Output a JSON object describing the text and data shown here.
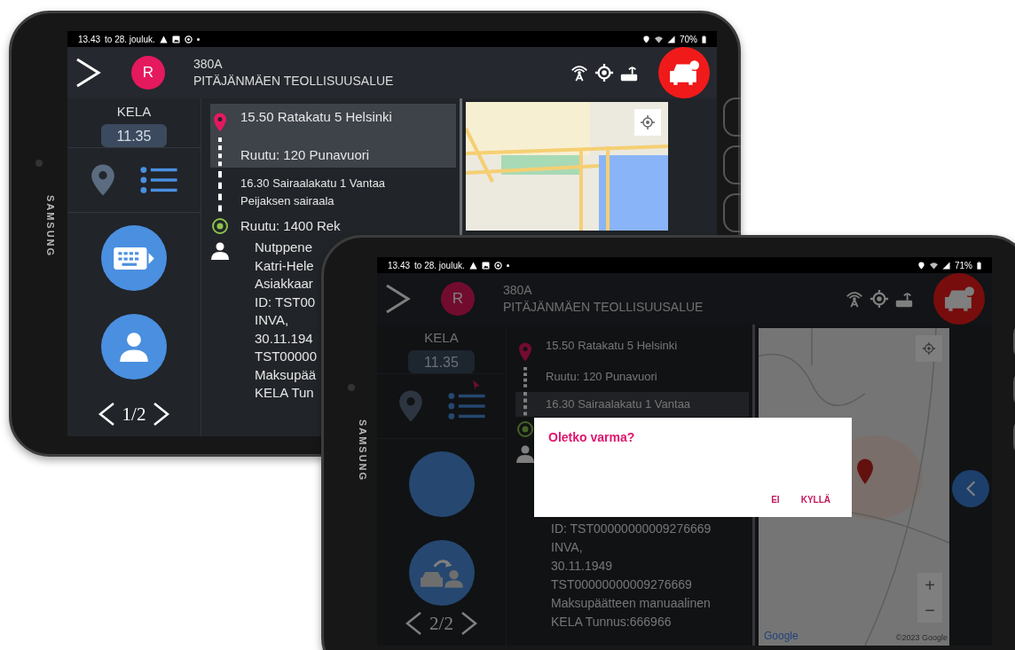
{
  "tablets": [
    {
      "brand": "SAMSUNG",
      "status": {
        "time": "13.43",
        "date": "to 28. jouluk.",
        "battery": "70%"
      },
      "header": {
        "avatar": "R",
        "code": "380A",
        "name": "PITÄJÄNMÄEN TEOLLISUUSALUE"
      },
      "sidebar": {
        "label": "KELA",
        "time": "11.35",
        "buttons": [
          {
            "kind": "keyboard"
          },
          {
            "kind": "person"
          }
        ],
        "pager": "1/2"
      },
      "stops": [
        {
          "kind": "pickup",
          "highlighted": true,
          "lines": [
            "15.50 Ratakatu 5 Helsinki",
            "Ruutu: 120 Punavuori"
          ]
        },
        {
          "kind": "dropoff",
          "highlighted": false,
          "lines": [
            "16.30 Sairaalakatu 1 Vantaa",
            "Peijaksen sairaala"
          ]
        },
        {
          "kind": "destination",
          "highlighted": false,
          "lines": [
            "Ruutu: 1400 Rek"
          ]
        },
        {
          "kind": "customer",
          "highlighted": false,
          "lines": [
            "Nutppene",
            "Katri-Hele",
            "Asiakkaar",
            "ID: TST00",
            "INVA,",
            "30.11.194",
            "TST00000",
            "Maksupää",
            "KELA Tun"
          ]
        }
      ],
      "map": {
        "kind": "street"
      },
      "back_button": false,
      "cursor": false
    },
    {
      "brand": "SAMSUNG",
      "status": {
        "time": "13.43",
        "date": "to 28. jouluk.",
        "battery": "71%"
      },
      "header": {
        "avatar": "R",
        "code": "380A",
        "name": "PITÄJÄNMÄEN TEOLLISUUSALUE"
      },
      "sidebar": {
        "label": "KELA",
        "time": "11.35",
        "buttons": [
          {
            "kind": "blank"
          },
          {
            "kind": "swap"
          }
        ],
        "pager": "2/2"
      },
      "stops": [
        {
          "kind": "pickup",
          "highlighted": false,
          "lines": [
            "15.50 Ratakatu 5 Helsinki",
            "Ruutu: 120 Punavuori"
          ]
        },
        {
          "kind": "dropoff",
          "highlighted": true,
          "lines": [
            "16.30 Sairaalakatu 1 Vantaa"
          ]
        },
        {
          "kind": "destination",
          "highlighted": false
        },
        {
          "kind": "customer",
          "highlighted": false,
          "lines": [
            "ID: TST00000000009276669",
            "INVA,",
            "30.11.1949",
            "TST00000000009276669",
            "Maksupäätteen manuaalinen",
            "KELA Tunnus:666966"
          ]
        }
      ],
      "map": {
        "kind": "area",
        "zoom_in": "+",
        "zoom_out": "−",
        "logo": "Google",
        "copyright": "©2023 Google"
      },
      "back_button": true,
      "cursor": true,
      "dialog": {
        "title": "Oletko varma?",
        "buttons": [
          "EI",
          "KYLLÄ"
        ]
      }
    }
  ]
}
